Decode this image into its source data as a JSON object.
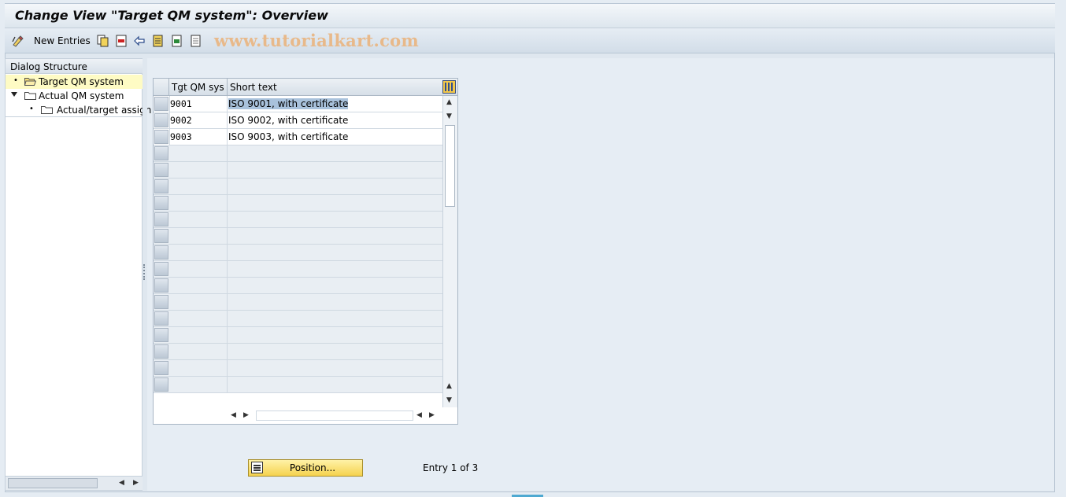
{
  "title": "Change View \"Target QM system\": Overview",
  "toolbar": {
    "new_entries_label": "New Entries",
    "watermark": "www.tutorialkart.com"
  },
  "dialog_structure": {
    "header": "Dialog Structure",
    "items": [
      {
        "label": "Target QM system",
        "selected": true
      },
      {
        "label": "Actual QM system",
        "expanded": true
      },
      {
        "label": "Actual/target assign"
      }
    ]
  },
  "table": {
    "columns": [
      "Tgt QM sys",
      "Short text"
    ],
    "rows": [
      {
        "code": "9001",
        "text": "ISO 9001, with certificate"
      },
      {
        "code": "9002",
        "text": "ISO 9002, with certificate"
      },
      {
        "code": "9003",
        "text": "ISO 9003, with certificate"
      }
    ]
  },
  "position_button": "Position...",
  "entry_info": "Entry 1 of 3",
  "colors": {
    "selected_tree_item": "#fefbc4",
    "highlight_cell": "#a9c2dc",
    "button_yellow": "#f5d24e"
  }
}
